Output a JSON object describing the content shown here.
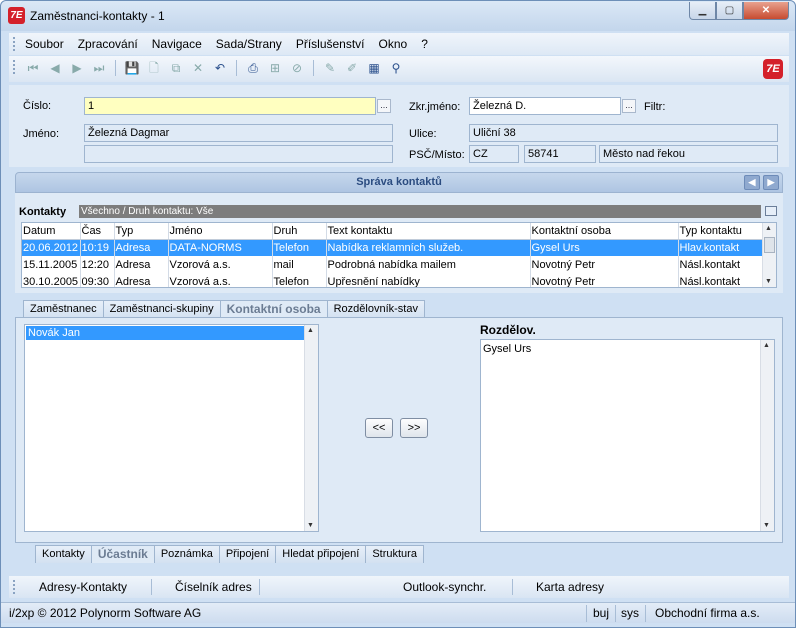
{
  "window": {
    "title": "Zaměstnanci-kontakty - 1",
    "app_icon_text": "7E"
  },
  "menu": [
    "Soubor",
    "Zpracování",
    "Navigace",
    "Sada/Strany",
    "Příslušenství",
    "Okno",
    "?"
  ],
  "form": {
    "cislo_label": "Číslo:",
    "cislo_value": "1",
    "jmeno_label": "Jméno:",
    "jmeno_value": "Železná Dagmar",
    "jmeno_value2": "",
    "zkr_label": "Zkr.jméno:",
    "zkr_value": "Železná D.",
    "filtr_label": "Filtr:",
    "ulice_label": "Ulice:",
    "ulice_value": "Uliční 38",
    "psc_label": "PSČ/Místo:",
    "country": "CZ",
    "psc": "58741",
    "misto": "Město nad řekou"
  },
  "section_title": "Správa kontaktů",
  "contacts": {
    "label": "Kontakty",
    "filter": "Všechno / Druh kontaktu: Vše",
    "columns": [
      "Datum",
      "Čas",
      "Typ",
      "Jméno",
      "Druh",
      "Text kontaktu",
      "Kontaktní osoba",
      "Typ kontaktu"
    ],
    "rows": [
      [
        "20.06.2012",
        "10:19",
        "Adresa",
        "DATA-NORMS",
        "Telefon",
        "Nabídka reklamních služeb.",
        "Gysel Urs",
        "Hlav.kontakt"
      ],
      [
        "15.11.2005",
        "12:20",
        "Adresa",
        "Vzorová a.s.",
        "mail",
        "Podrobná nabídka mailem",
        "Novotný Petr",
        "Násl.kontakt"
      ],
      [
        "30.10.2005",
        "09:30",
        "Adresa",
        "Vzorová a.s.",
        "Telefon",
        "Upřesnění nabídky",
        "Novotný Petr",
        "Násl.kontakt"
      ]
    ]
  },
  "tabs_top": [
    "Zaměstnanec",
    "Zaměstnanci-skupiny",
    "Kontaktní osoba",
    "Rozdělovník-stav"
  ],
  "tabs_top_active": 2,
  "panel": {
    "left_items": [
      "Novák Jan"
    ],
    "right_label": "Rozdělov.",
    "right_items": [
      "Gysel Urs"
    ],
    "btn_left": "<<",
    "btn_right": ">>"
  },
  "tabs_bottom": [
    "Kontakty",
    "Účastník",
    "Poznámka",
    "Připojení",
    "Hledat připojení",
    "Struktura"
  ],
  "tabs_bottom_active": 1,
  "actions": [
    "Adresy-Kontakty",
    "Číselník adres",
    "Outlook-synchr.",
    "Karta adresy"
  ],
  "status": {
    "copyright": "i/2xp © 2012 Polynorm Software AG",
    "user": "buj",
    "db": "sys",
    "firm": "Obchodní firma a.s."
  }
}
